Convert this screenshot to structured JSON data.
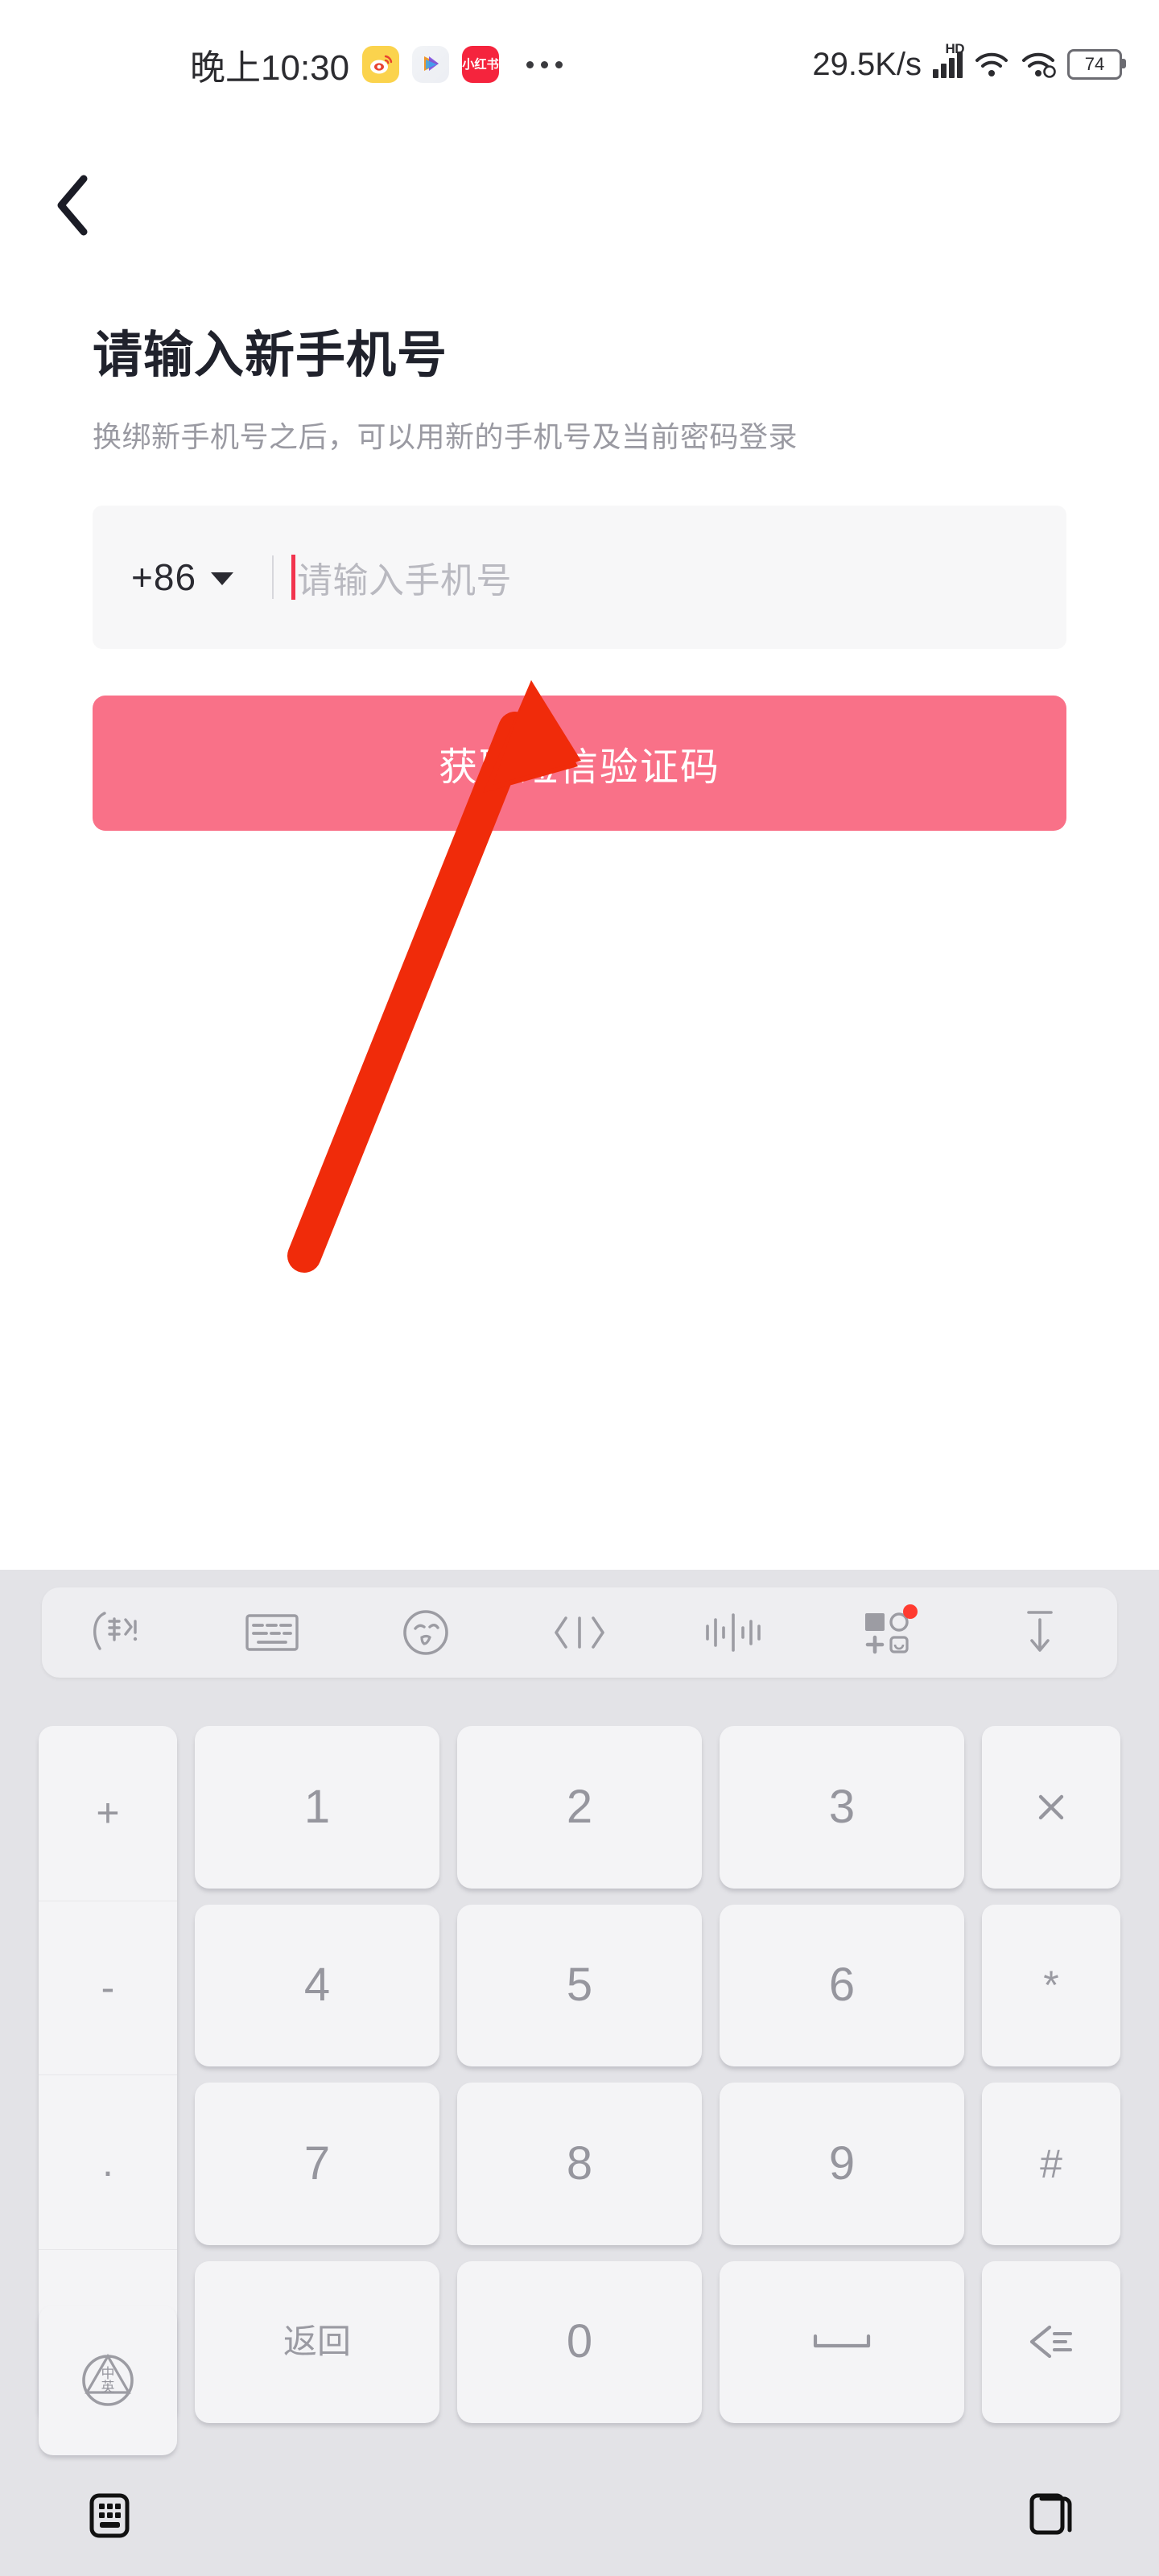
{
  "status_bar": {
    "time": "晚上10:30",
    "network_speed": "29.5K/s",
    "hd_label": "HD",
    "battery_level": "74",
    "notification_icons": [
      {
        "name": "weibo-icon",
        "label": "微博"
      },
      {
        "name": "video-player-icon",
        "label": "视频"
      },
      {
        "name": "xiaohongshu-icon",
        "label": "小红书"
      }
    ],
    "overflow_label": "•••"
  },
  "navbar": {
    "back_icon": "chevron-left-icon"
  },
  "main": {
    "title": "请输入新手机号",
    "subtitle": "换绑新手机号之后，可以用新的手机号及当前密码登录",
    "country_code": "+86",
    "phone_placeholder": "请输入手机号",
    "phone_value": "",
    "submit_label": "获取短信验证码",
    "accent_color": "#F97188",
    "cursor_color": "#F2344E",
    "arrow_color": "#F02B0A"
  },
  "keyboard": {
    "toolbar": [
      {
        "name": "sogou-logo-icon",
        "label": "搜狗输入法"
      },
      {
        "name": "keyboard-layout-icon",
        "label": "键盘布局"
      },
      {
        "name": "emoji-face-icon",
        "label": "表情"
      },
      {
        "name": "symbols-icon",
        "label": "符号"
      },
      {
        "name": "voice-wave-icon",
        "label": "语音"
      },
      {
        "name": "toolbox-icon",
        "label": "工具箱",
        "badge": true
      },
      {
        "name": "collapse-keyboard-icon",
        "label": "收起"
      }
    ],
    "side_keys": [
      "+",
      "-",
      ".",
      ","
    ],
    "rows": [
      [
        "1",
        "2",
        "3"
      ],
      [
        "4",
        "5",
        "6"
      ],
      [
        "7",
        "8",
        "9"
      ],
      [
        "返回",
        "0",
        "␣"
      ]
    ],
    "right_keys": [
      "✕",
      "*",
      "#",
      "◁"
    ],
    "lang_key_label": "中英",
    "space_key_label": "␣",
    "bottom_nav": [
      {
        "name": "keyboard-switch-icon",
        "label": "键盘"
      },
      {
        "name": "recents-icon",
        "label": "多任务"
      }
    ]
  }
}
